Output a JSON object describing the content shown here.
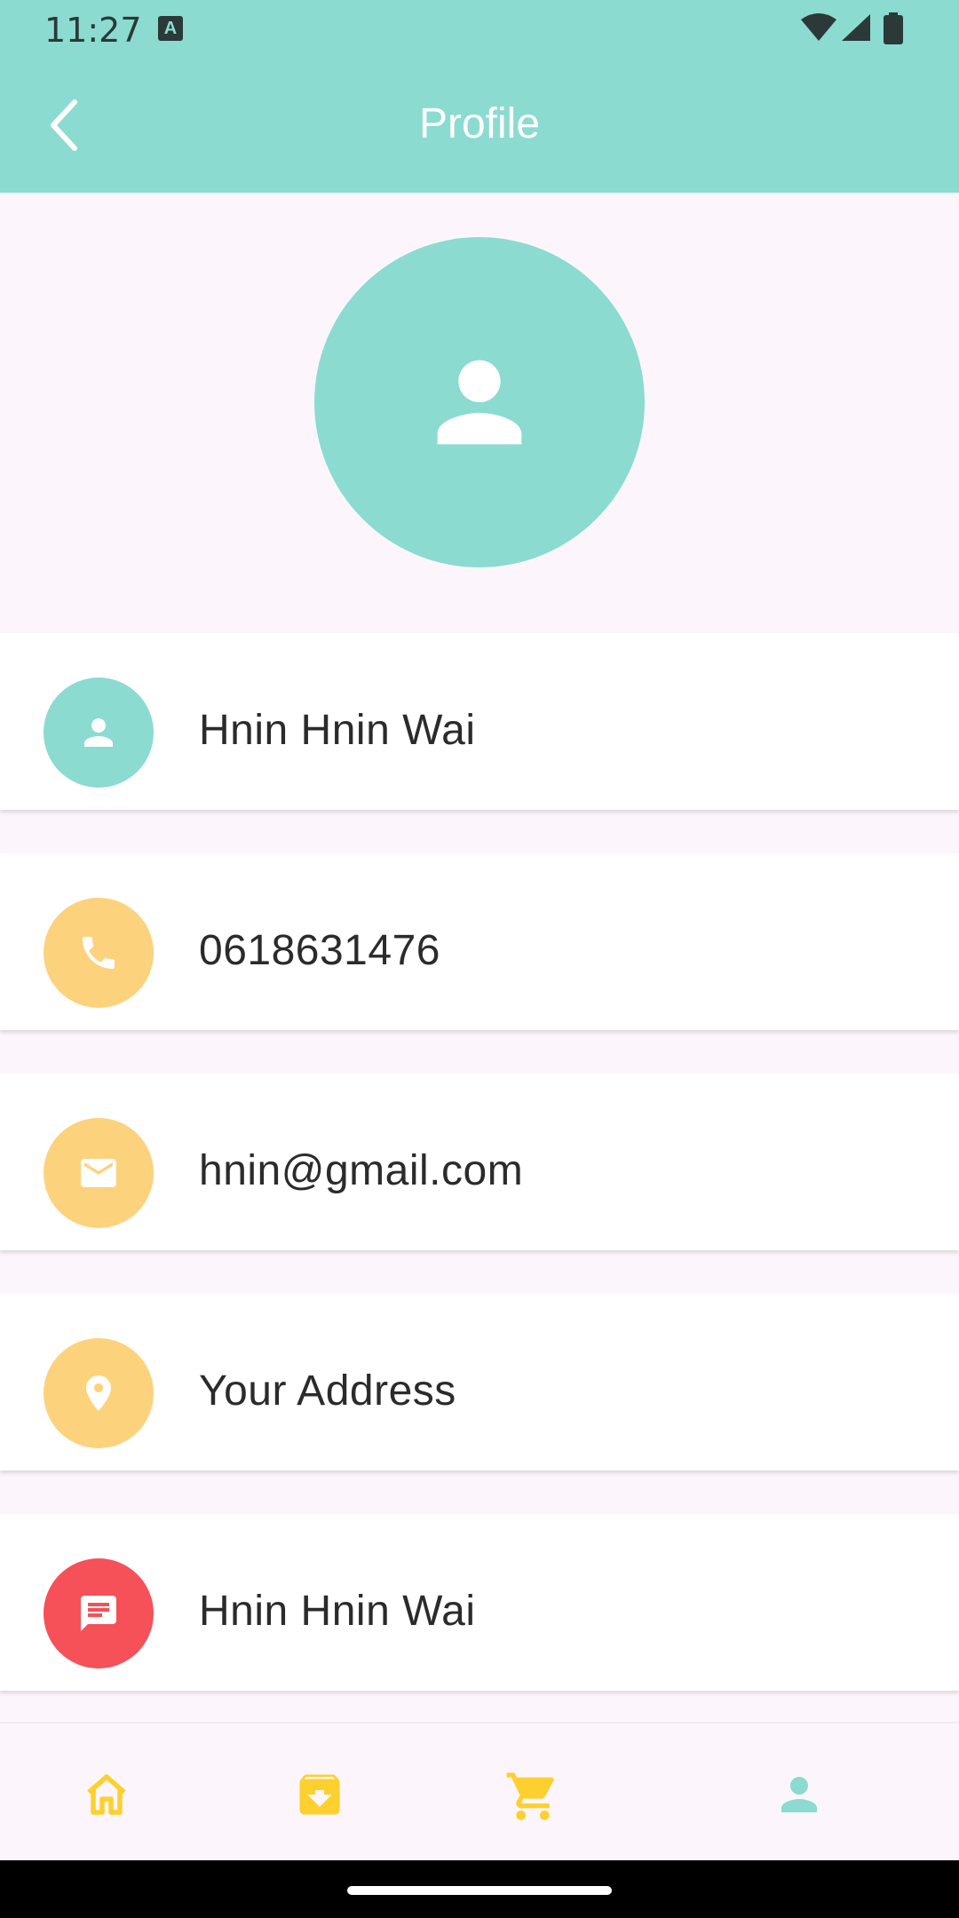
{
  "status_bar": {
    "time": "11:27",
    "notification_icon": "keyboard-a-icon",
    "icons": [
      "wifi-icon",
      "signal-icon",
      "battery-icon"
    ]
  },
  "app_bar": {
    "title": "Profile",
    "back_icon": "chevron-left-icon"
  },
  "profile": {
    "avatar_icon": "person-icon"
  },
  "rows": [
    {
      "label": "Hnin Hnin Wai",
      "icon": "person-icon",
      "color": "#8bdbd1"
    },
    {
      "label": "0618631476",
      "icon": "phone-icon",
      "color": "#fdd27c"
    },
    {
      "label": "hnin@gmail.com",
      "icon": "mail-icon",
      "color": "#fdd27c"
    },
    {
      "label": "Your Address",
      "icon": "location-pin-icon",
      "color": "#fdd27c"
    },
    {
      "label": "Hnin Hnin Wai",
      "icon": "message-icon",
      "color": "#f65058"
    }
  ],
  "bottom_nav": {
    "items": [
      {
        "icon": "home-icon",
        "color": "#fdd02f"
      },
      {
        "icon": "archive-icon",
        "color": "#fdd02f"
      },
      {
        "icon": "cart-icon",
        "color": "#fdd02f"
      },
      {
        "icon": "profile-icon",
        "color": "#8bdbd1",
        "active": true
      }
    ]
  },
  "colors": {
    "primary": "#8bdbd1",
    "accent": "#fdd27c",
    "alert": "#f65058",
    "background": "#fcf6fc"
  }
}
